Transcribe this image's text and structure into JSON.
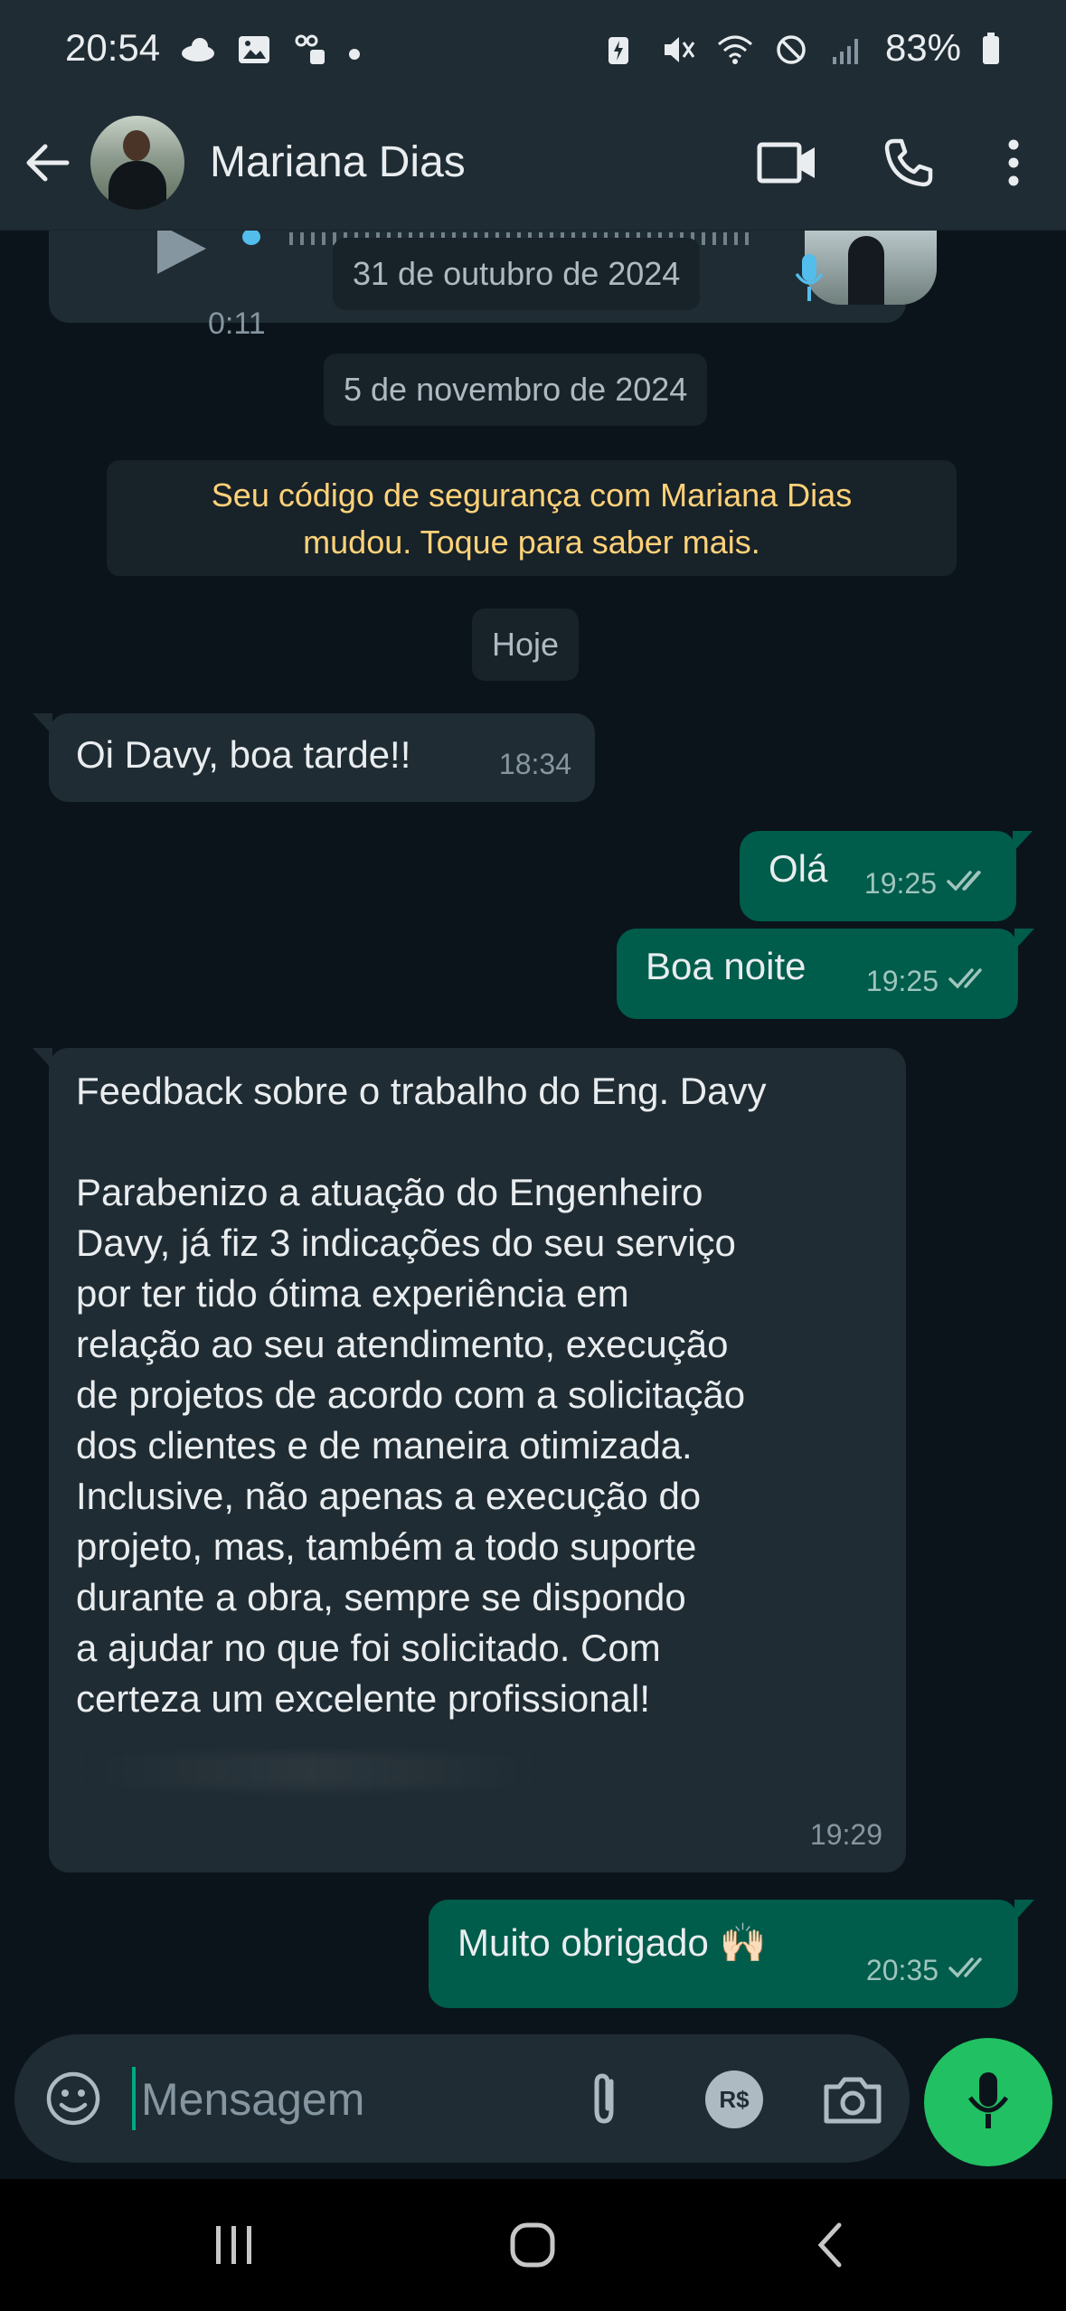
{
  "status_bar": {
    "time": "20:54",
    "battery": "83%"
  },
  "header": {
    "contact_name": "Mariana Dias"
  },
  "chat": {
    "audio_message": {
      "duration": "0:11"
    },
    "date_pills": {
      "first": "31 de outubro de 2024",
      "second": "5 de novembro de 2024",
      "third": "Hoje"
    },
    "system_message": {
      "line1": "Seu código de segurança com Mariana Dias",
      "line2": "mudou. Toque para saber mais."
    },
    "messages": [
      {
        "direction": "in",
        "text": "Oi Davy, boa tarde!!",
        "time": "18:34"
      },
      {
        "direction": "out",
        "text": "Olá",
        "time": "19:25",
        "status": "read"
      },
      {
        "direction": "out",
        "text": "Boa noite",
        "time": "19:25",
        "status": "read"
      },
      {
        "direction": "in",
        "text": "Feedback sobre o trabalho do Eng. Davy\n\nParabenizo a atuação do Engenheiro\nDavy, já fiz 3 indicações do seu serviço\npor ter tido ótima experiência em\nrelação ao seu atendimento, execução\nde projetos de acordo com a solicitação\ndos clientes e de maneira otimizada.\nInclusive, não apenas a execução do\nprojeto, mas, também a todo suporte\ndurante a obra, sempre se dispondo\na ajudar no que foi solicitado. Com\ncerteza um excelente profissional!",
        "time": "19:29"
      },
      {
        "direction": "out",
        "text": "Muito obrigado 🙌🏻",
        "time": "20:35",
        "status": "read"
      }
    ]
  },
  "composer": {
    "placeholder": "Mensagem",
    "pay_label": "R$"
  },
  "colors": {
    "background": "#0b141a",
    "header": "#1f2c34",
    "incoming_bubble": "#202c33",
    "outgoing_bubble": "#005c4b",
    "accent": "#21c063",
    "system_text": "#ffd279"
  }
}
